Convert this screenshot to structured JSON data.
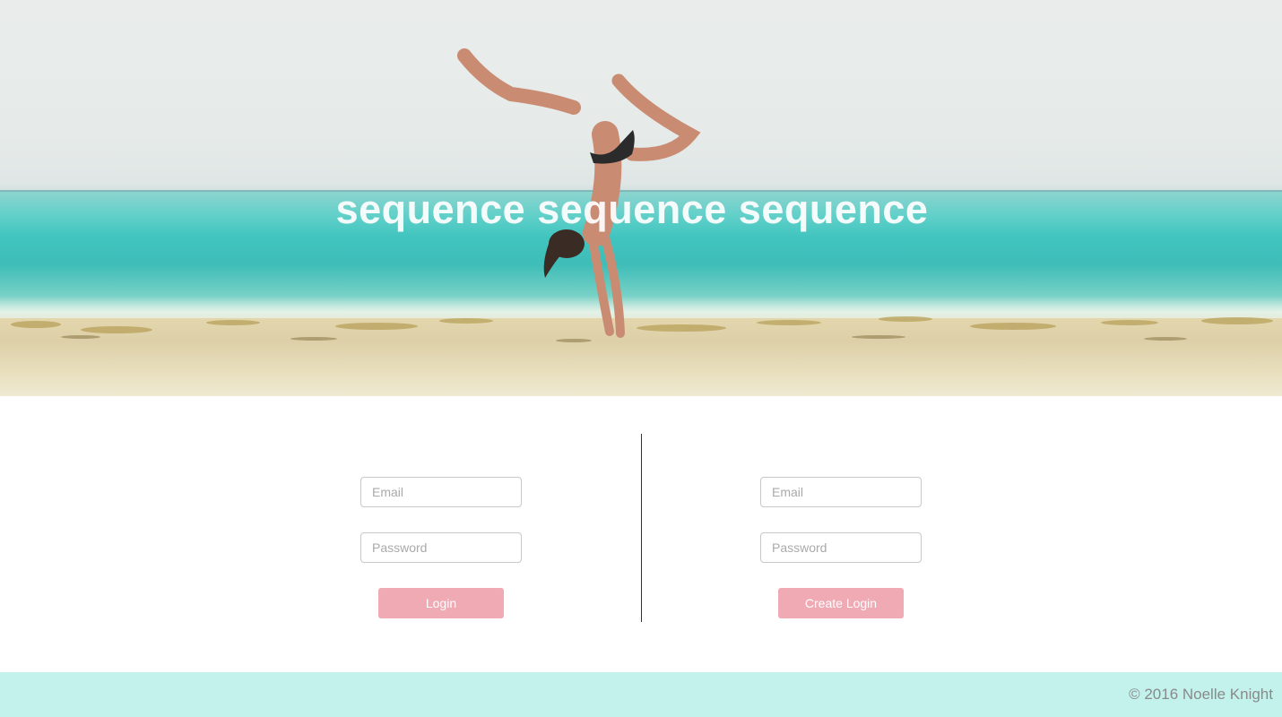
{
  "hero": {
    "title": "sequence sequence sequence",
    "image_subject": "person-doing-handstand-on-beach"
  },
  "login_form": {
    "email_placeholder": "Email",
    "password_placeholder": "Password",
    "button_label": "Login"
  },
  "signup_form": {
    "email_placeholder": "Email",
    "password_placeholder": "Password",
    "button_label": "Create Login"
  },
  "footer": {
    "copyright": "© 2016 Noelle Knight"
  },
  "colors": {
    "button": "#f0aab4",
    "footer_bg": "#c2f2eb",
    "divider": "#333333"
  }
}
